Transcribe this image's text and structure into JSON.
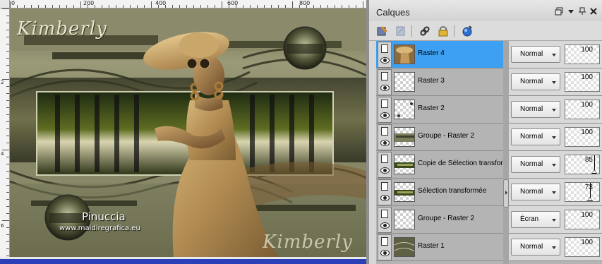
{
  "rulers": {
    "top_labels": [
      "0",
      "200",
      "400",
      "600",
      "800"
    ],
    "left_labels": [
      "2",
      "4",
      "6"
    ]
  },
  "artwork": {
    "title_top": "Kimberly",
    "title_bottom": "Kimberly",
    "author": "Pinuccia",
    "website": "www.maidiregrafica.eu"
  },
  "panel": {
    "title": "Calques",
    "header_icons": [
      "restore-window-icon",
      "menu-arrow-icon",
      "pin-icon",
      "close-icon"
    ],
    "toolbar_icons": [
      "new-raster-layer-icon",
      "new-vector-layer-icon",
      "link-layers-icon",
      "lock-layer-icon",
      "layer-properties-icon"
    ]
  },
  "layers": [
    {
      "name": "Raster 4",
      "blend": "Normal",
      "opacity": "100",
      "opacity_fraction": 1.0,
      "selected": true,
      "thumb": "woman"
    },
    {
      "name": "Raster 3",
      "blend": "Normal",
      "opacity": "100",
      "opacity_fraction": 1.0,
      "selected": false,
      "thumb": "empty"
    },
    {
      "name": "Raster 2",
      "blend": "Normal",
      "opacity": "100",
      "opacity_fraction": 1.0,
      "selected": false,
      "thumb": "dots"
    },
    {
      "name": "Groupe - Raster 2",
      "blend": "Normal",
      "opacity": "100",
      "opacity_fraction": 1.0,
      "selected": false,
      "thumb": "texture"
    },
    {
      "name": "Copie de Sélection transformé",
      "blend": "Normal",
      "opacity": "85",
      "opacity_fraction": 0.85,
      "selected": false,
      "thumb": "strip"
    },
    {
      "name": "Sélection transformée",
      "blend": "Normal",
      "opacity": "73",
      "opacity_fraction": 0.73,
      "selected": false,
      "thumb": "strip"
    },
    {
      "name": "Groupe - Raster 2",
      "blend": "Écran",
      "opacity": "100",
      "opacity_fraction": 1.0,
      "selected": false,
      "thumb": "empty"
    },
    {
      "name": "Raster 1",
      "blend": "Normal",
      "opacity": "100",
      "opacity_fraction": 1.0,
      "selected": false,
      "thumb": "swirl"
    }
  ],
  "colors": {
    "selected_layer": "#3ea0f2",
    "artwork_olive": "#7e7f5e",
    "skin_tan": "#c8a36a"
  }
}
